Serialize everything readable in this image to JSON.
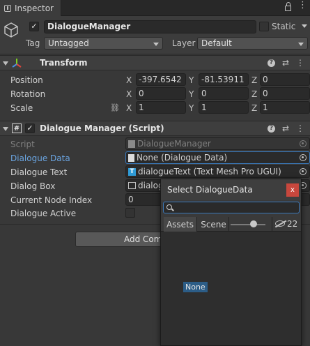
{
  "window": {
    "tab_title": "Inspector"
  },
  "gameobject": {
    "active": true,
    "name": "DialogueManager",
    "static_label": "Static",
    "tag_label": "Tag",
    "tag_value": "Untagged",
    "layer_label": "Layer",
    "layer_value": "Default"
  },
  "transform": {
    "title": "Transform",
    "position_label": "Position",
    "rotation_label": "Rotation",
    "scale_label": "Scale",
    "axes": [
      "X",
      "Y",
      "Z"
    ],
    "position": [
      "-397.6542",
      "-81.53911",
      "0"
    ],
    "rotation": [
      "0",
      "0",
      "0"
    ],
    "scale": [
      "1",
      "1",
      "1"
    ]
  },
  "script_component": {
    "title": "Dialogue Manager (Script)",
    "fields": [
      {
        "label": "Script",
        "value": "DialogueManager"
      },
      {
        "label": "Dialogue Data",
        "value": "None (Dialogue Data)"
      },
      {
        "label": "Dialogue Text",
        "value": "dialogueText (Text Mesh Pro UGUI)"
      },
      {
        "label": "Dialog Box",
        "value": "dialog"
      },
      {
        "label": "Current Node Index",
        "value": "0"
      },
      {
        "label": "Dialogue Active",
        "value": ""
      }
    ]
  },
  "add_component_label": "Add Comp",
  "popup": {
    "title": "Select DialogueData",
    "close_label": "x",
    "search_value": "",
    "tabs": [
      "Assets",
      "Scene"
    ],
    "hidden_count": "22",
    "items": [
      "None"
    ]
  },
  "icons": {
    "gameobject": "cube-icon",
    "transform": "transform-axes-icon",
    "script": "script-hash-icon"
  },
  "colors": {
    "background": "#383838",
    "focus_blue": "#3a79bb",
    "link_blue": "#6aa4e0",
    "close_red": "#c7473d",
    "selection": "#2c5d87"
  }
}
